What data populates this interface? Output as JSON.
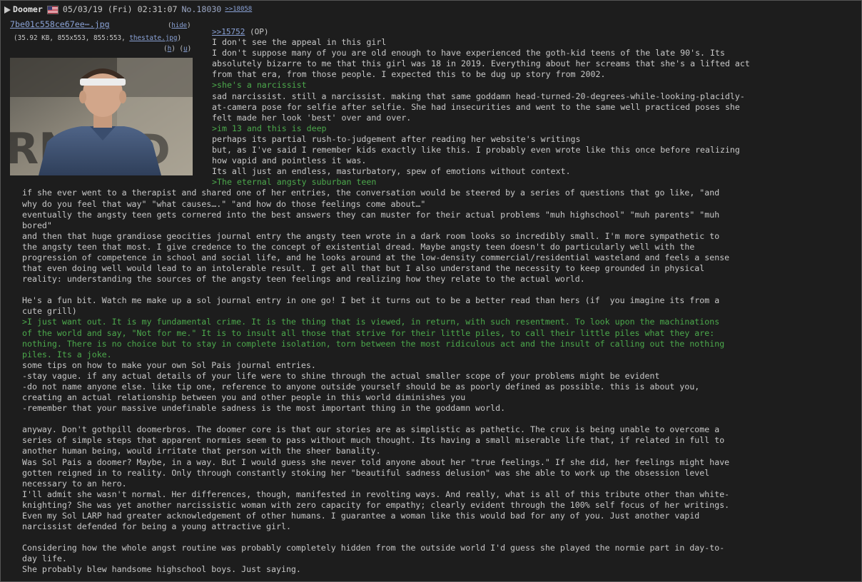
{
  "header": {
    "name": "Doomer",
    "date": "05/03/19 (Fri) 02:31:07",
    "post_no": "No.18030",
    "reply_link": ">>18058"
  },
  "file": {
    "name": "7be01c558ce67ee⋯.jpg",
    "hide_label": "hide",
    "info_prefix": "(35.92 KB, 855x553, 855:553, ",
    "info_filename": "thestate.jpg",
    "info_suffix": ")",
    "h_label": "h",
    "u_label": "u"
  },
  "post": {
    "ref": ">>15752",
    "op_label": "(OP)",
    "lines": [
      {
        "text": "I don't see the appeal in this girl",
        "quote": false,
        "ind": true
      },
      {
        "text": "I don't suppose many of you are old enough to have experienced the goth-kid teens of the late 90's. Its",
        "quote": false,
        "ind": true
      },
      {
        "text": "absolutely bizarre to me that this girl was 18 in 2019. Everything about her screams that she's a lifted act",
        "quote": false,
        "ind": true
      },
      {
        "text": "from that era, from those people. I expected this to be dug up story from 2002.",
        "quote": false,
        "ind": true
      },
      {
        "text": ">she's a narcissist",
        "quote": true,
        "ind": true
      },
      {
        "text": "sad narcissist. still a narcissist. making that same goddamn head-turned-20-degrees-while-looking-placidly-",
        "quote": false,
        "ind": true
      },
      {
        "text": "at-camera pose for selfie after selfie. She had insecurities and went to the same well practiced poses she",
        "quote": false,
        "ind": true
      },
      {
        "text": "felt made her look 'best' over and over.",
        "quote": false,
        "ind": true
      },
      {
        "text": ">im 13 and this is deep",
        "quote": true,
        "ind": true
      },
      {
        "text": "perhaps its partial rush-to-judgement after reading her website's writings",
        "quote": false,
        "ind": true
      },
      {
        "text": "but, as I've said I remember kids exactly like this. I probably even wrote like this once before realizing",
        "quote": false,
        "ind": true
      },
      {
        "text": "how vapid and pointless it was.",
        "quote": false,
        "ind": true
      },
      {
        "text": "Its all just an endless, masturbatory, spew of emotions without context.",
        "quote": false,
        "ind": true
      },
      {
        "text": ">The eternal angsty suburban teen",
        "quote": true,
        "ind": true
      },
      {
        "text": "if she ever went to a therapist and shared one of her entries, the conversation would be steered by a series of questions that go like, \"and",
        "quote": false,
        "ind": false
      },
      {
        "text": "why do you feel that way\" \"what causes….\" \"and how do those feelings come about…\"",
        "quote": false,
        "ind": false
      },
      {
        "text": "eventually the angsty teen gets cornered into the best answers they can muster for their actual problems \"muh highschool\" \"muh parents\" \"muh",
        "quote": false,
        "ind": false
      },
      {
        "text": "bored\"",
        "quote": false,
        "ind": false
      },
      {
        "text": "and then that huge grandiose geocities journal entry the angsty teen wrote in a dark room looks so incredibly small. I'm more sympathetic to",
        "quote": false,
        "ind": false
      },
      {
        "text": "the angsty teen that most. I give credence to the concept of existential dread. Maybe angsty teen doesn't do particularly well with the",
        "quote": false,
        "ind": false
      },
      {
        "text": "progression of competence in school and social life, and he looks around at the low-density commercial/residential wasteland and feels a sense",
        "quote": false,
        "ind": false
      },
      {
        "text": "that even doing well would lead to an intolerable result. I get all that but I also understand the necessity to keep grounded in physical",
        "quote": false,
        "ind": false
      },
      {
        "text": "reality: understanding the sources of the angsty teen feelings and realizing how they relate to the actual world.",
        "quote": false,
        "ind": false
      },
      {
        "text": "",
        "quote": false,
        "ind": false
      },
      {
        "text": "He's a fun bit. Watch me make up a sol journal entry in one go! I bet it turns out to be a better read than hers (if  you imagine its from a",
        "quote": false,
        "ind": false
      },
      {
        "text": "cute grill)",
        "quote": false,
        "ind": false
      },
      {
        "text": ">I just want out. It is my fundamental crime. It is the thing that is viewed, in return, with such resentment. To look upon the machinations",
        "quote": true,
        "ind": false
      },
      {
        "text": "of the world and say, \"Not for me.\" It is to insult all those that strive for their little piles, to call their little piles what they are:",
        "quote": true,
        "ind": false
      },
      {
        "text": "nothing. There is no choice but to stay in complete isolation, torn between the most ridiculous act and the insult of calling out the nothing",
        "quote": true,
        "ind": false
      },
      {
        "text": "piles. Its a joke.",
        "quote": true,
        "ind": false
      },
      {
        "text": "some tips on how to make your own Sol Pais journal entries.",
        "quote": false,
        "ind": false
      },
      {
        "text": "-stay vague. if any actual details of your life were to shine through the actual smaller scope of your problems might be evident",
        "quote": false,
        "ind": false
      },
      {
        "text": "-do not name anyone else. like tip one, reference to anyone outside yourself should be as poorly defined as possible. this is about you,",
        "quote": false,
        "ind": false
      },
      {
        "text": "creating an actual relationship between you and other people in this world diminishes you",
        "quote": false,
        "ind": false
      },
      {
        "text": "-remember that your massive undefinable sadness is the most important thing in the goddamn world.",
        "quote": false,
        "ind": false
      },
      {
        "text": "",
        "quote": false,
        "ind": false
      },
      {
        "text": "anyway. Don't gothpill doomerbros. The doomer core is that our stories are as simplistic as pathetic. The crux is being unable to overcome a",
        "quote": false,
        "ind": false
      },
      {
        "text": "series of simple steps that apparent normies seem to pass without much thought. Its having a small miserable life that, if related in full to",
        "quote": false,
        "ind": false
      },
      {
        "text": "another human being, would irritate that person with the sheer banality.",
        "quote": false,
        "ind": false
      },
      {
        "text": "Was Sol Pais a doomer? Maybe, in a way. But I would guess she never told anyone about her \"true feelings.\" If she did, her feelings might have",
        "quote": false,
        "ind": false
      },
      {
        "text": "gotten reigned in to reality. Only through constantly stoking her \"beautiful sadness delusion\" was she able to work up the obsession level",
        "quote": false,
        "ind": false
      },
      {
        "text": "necessary to an hero.",
        "quote": false,
        "ind": false
      },
      {
        "text": "I'll admit she wasn't normal. Her differences, though, manifested in revolting ways. And really, what is all of this tribute other than white-",
        "quote": false,
        "ind": false
      },
      {
        "text": "knighting? She was yet another narcissistic woman with zero capacity for empathy; clearly evident through the 100% self focus of her writings.",
        "quote": false,
        "ind": false
      },
      {
        "text": "Even my Sol LARP had greater acknowledgement of other humans. I guarantee a woman like this would bad for any of you. Just another vapid",
        "quote": false,
        "ind": false
      },
      {
        "text": "narcissist defended for being a young attractive girl.",
        "quote": false,
        "ind": false
      },
      {
        "text": "",
        "quote": false,
        "ind": false
      },
      {
        "text": "Considering how the whole angst routine was probably completely hidden from the outside world I'd guess she played the normie part in day-to-",
        "quote": false,
        "ind": false
      },
      {
        "text": "day life.",
        "quote": false,
        "ind": false
      },
      {
        "text": "She probably blew handsome highschool boys. Just saying.",
        "quote": false,
        "ind": false
      }
    ]
  },
  "colors": {
    "background": "#1d1d1d",
    "text": "#c8c8c8",
    "link": "#8aa2d6",
    "greentext": "#4ca94c"
  }
}
